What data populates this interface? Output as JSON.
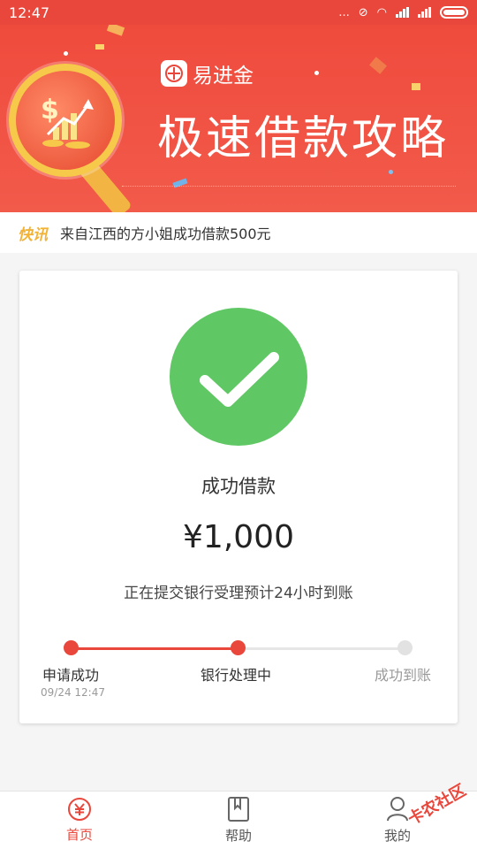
{
  "status_bar": {
    "time": "12:47",
    "dots": "..."
  },
  "banner": {
    "brand": "易进金",
    "title": "极速借款攻略"
  },
  "news": {
    "tag": "快讯",
    "text": "来自江西的方小姐成功借款500元"
  },
  "card": {
    "status": "成功借款",
    "amount": "¥1,000",
    "note": "正在提交银行受理预计24小时到账",
    "steps": [
      {
        "label": "申请成功",
        "date": "09/24 12:47",
        "state": "done"
      },
      {
        "label": "银行处理中",
        "state": "current"
      },
      {
        "label": "成功到账",
        "state": "pending"
      }
    ]
  },
  "tabbar": {
    "tabs": [
      {
        "label": "首页",
        "icon": "yuan-icon",
        "active": true
      },
      {
        "label": "帮助",
        "icon": "book-icon",
        "active": false
      },
      {
        "label": "我的",
        "icon": "person-icon",
        "active": false
      }
    ]
  },
  "watermark": "卡农社区",
  "colors": {
    "primary": "#e9473c",
    "success": "#5fc764",
    "accent": "#f2b236",
    "pending": "#e0e0e0"
  }
}
